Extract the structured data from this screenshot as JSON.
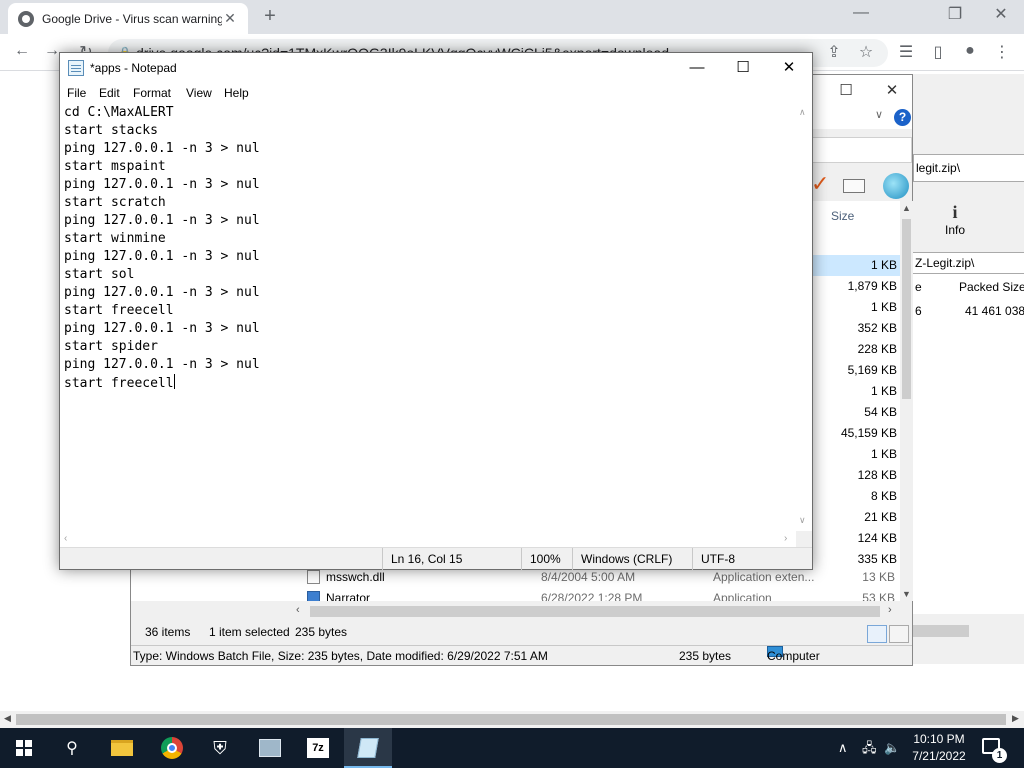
{
  "browser": {
    "tab_title": "Google Drive - Virus scan warning",
    "url": "drive.google.com/uc?id=1TMxKwrQOG3Ik9oLKVVqgQcvvWCiCLi5&export=download",
    "tab_close": "✕",
    "new_tab": "+",
    "minimize": "—",
    "restore": "❐",
    "close": "✕"
  },
  "sevenzip": {
    "archive_path": "legit.zip\\",
    "info_label": "Info",
    "path": "Z-Legit.zip\\",
    "col_packed": "Packed Size",
    "col_prefix": "e",
    "row_num": "6",
    "row_packed": "41 461 038"
  },
  "explorer": {
    "col_size": "Size",
    "sizes": [
      "1 KB",
      "1,879 KB",
      "1 KB",
      "352 KB",
      "228 KB",
      "5,169 KB",
      "1 KB",
      "54 KB",
      "45,159 KB",
      "1 KB",
      "128 KB",
      "8 KB",
      "21 KB",
      "124 KB",
      "335 KB",
      "13 KB",
      "53 KB"
    ],
    "files": [
      {
        "name": "msswch.dll",
        "date": "8/4/2004 5:00 AM",
        "type": "Application exten..."
      },
      {
        "name": "Narrator",
        "date": "6/28/2022 1:28 PM",
        "type": "Application"
      }
    ],
    "status_items": "36 items",
    "status_selected": "1 item selected",
    "status_size": "235 bytes",
    "details_text": "Type: Windows Batch File, Size: 235 bytes, Date modified: 6/29/2022 7:51 AM",
    "details_size": "235 bytes",
    "details_location": "Computer"
  },
  "notepad": {
    "title": "*apps - Notepad",
    "menu": [
      "File",
      "Edit",
      "Format",
      "View",
      "Help"
    ],
    "lines": [
      "cd C:\\MaxALERT",
      "start stacks",
      "ping 127.0.0.1 -n 3 > nul",
      "start mspaint",
      "ping 127.0.0.1 -n 3 > nul",
      "start scratch",
      "ping 127.0.0.1 -n 3 > nul",
      "start winmine",
      "ping 127.0.0.1 -n 3 > nul",
      "start sol",
      "ping 127.0.0.1 -n 3 > nul",
      "start freecell",
      "ping 127.0.0.1 -n 3 > nul",
      "start spider",
      "ping 127.0.0.1 -n 3 > nul",
      "start freecell"
    ],
    "status": {
      "position": "Ln 16, Col 15",
      "zoom": "100%",
      "line_ending": "Windows (CRLF)",
      "encoding": "UTF-8"
    }
  },
  "taskbar": {
    "time": "10:10 PM",
    "date": "7/21/2022",
    "notification_count": "1",
    "apps": [
      "start",
      "search",
      "file-explorer",
      "chrome",
      "security",
      "control-panel",
      "7zip",
      "notepad"
    ]
  },
  "colors": {
    "chrome_tabbar": "#dee1e6",
    "taskbar": "#101c2b",
    "selection": "#cce8ff",
    "help_blue": "#1b62c9"
  }
}
